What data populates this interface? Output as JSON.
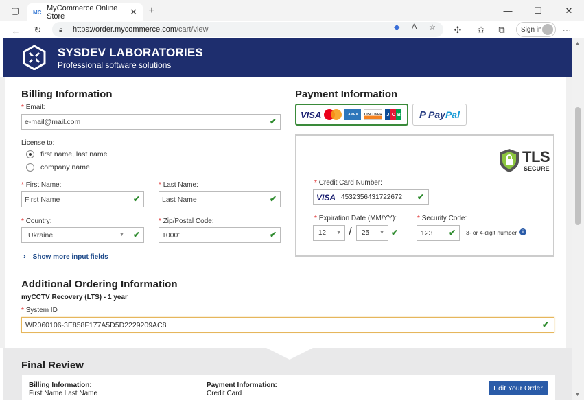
{
  "browser": {
    "tab_title": "MyCommerce Online Store",
    "tab_favicon": "MC",
    "url_host": "https://order.mycommerce.com",
    "url_path": "/cart/view",
    "signin_label": "Sign in"
  },
  "banner": {
    "brand": "SYSDEV LABORATORIES",
    "tagline": "Professional software solutions"
  },
  "billing": {
    "title": "Billing Information",
    "email_label": "Email:",
    "email_value": "e-mail@mail.com",
    "license_label": "License to:",
    "license_options": [
      "first name, last name",
      "company name"
    ],
    "license_selected": "first name, last name",
    "first_name_label": "First Name:",
    "first_name_value": "First Name",
    "last_name_label": "Last Name:",
    "last_name_value": "Last Name",
    "country_label": "Country:",
    "country_value": "Ukraine",
    "zip_label": "Zip/Postal Code:",
    "zip_value": "10001",
    "more_fields": "Show more input fields"
  },
  "payment": {
    "title": "Payment Information",
    "methods": [
      "Cards",
      "PayPal"
    ],
    "selected_method": "Cards",
    "tls_top": "TLS",
    "tls_bottom": "SECURE",
    "cc_label": "Credit Card Number:",
    "cc_brand": "VISA",
    "cc_value": "4532356431722672",
    "exp_label": "Expiration Date (MM/YY):",
    "exp_month": "12",
    "exp_year": "25",
    "cvv_label": "Security Code:",
    "cvv_value": "123",
    "cvv_hint": "3- or 4-digit number"
  },
  "additional": {
    "title": "Additional Ordering Information",
    "product": "myCCTV Recovery (LTS) - 1 year",
    "sysid_label": "System ID",
    "sysid_value": "WR060106-3E858F177A5D5D2229209AC8"
  },
  "final_review": {
    "title": "Final Review",
    "billing_header": "Billing Information:",
    "billing_value": "First Name Last Name",
    "payment_header": "Payment Information:",
    "payment_value": "Credit Card",
    "edit_button": "Edit Your Order"
  },
  "colors": {
    "banner_bg": "#1e2e6e",
    "valid_check": "#2e8b2e",
    "primary_button": "#2a5ba8",
    "required_mark": "#dd2222"
  }
}
